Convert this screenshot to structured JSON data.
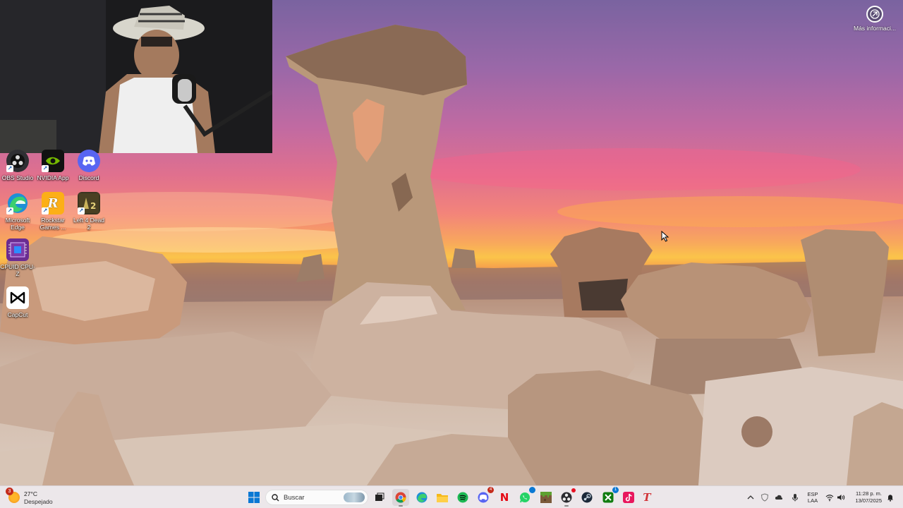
{
  "desktop": {
    "icons": [
      {
        "label": "OBS Studio",
        "icon": "obs-icon",
        "color": "#3a3a3a"
      },
      {
        "label": "NVIDIA App",
        "icon": "nvidia-icon",
        "color": "#76b900"
      },
      {
        "label": "Discord",
        "icon": "discord-icon",
        "color": "#5865f2"
      },
      {
        "label": "Microsoft Edge",
        "icon": "edge-icon",
        "color": "#1f8fd6"
      },
      {
        "label": "Rockstar Games ...",
        "icon": "rockstar-icon",
        "color": "#fcaf17"
      },
      {
        "label": "Left 4 Dead 2",
        "icon": "l4d2-icon",
        "color": "#3b3520"
      },
      {
        "label": "CPUID CPU-Z",
        "icon": "cpuz-icon",
        "color": "#6a2c91"
      },
      {
        "label": "CapCut",
        "icon": "capcut-icon",
        "color": "#ffffff"
      }
    ],
    "more_info": {
      "label": "Más informaci...",
      "icon": "camera-info-icon"
    }
  },
  "taskbar": {
    "weather": {
      "temp": "27°C",
      "condition": "Despejado",
      "badge": "3",
      "icon": "sun-icon"
    },
    "search": {
      "placeholder": "Buscar",
      "icon": "search-icon"
    },
    "pinned": [
      {
        "name": "start",
        "icon": "windows-start-icon"
      },
      {
        "name": "task-view",
        "icon": "task-view-icon"
      },
      {
        "name": "chrome",
        "icon": "chrome-icon"
      },
      {
        "name": "edge",
        "icon": "edge-icon"
      },
      {
        "name": "file-explorer",
        "icon": "folder-icon"
      },
      {
        "name": "spotify",
        "icon": "spotify-icon"
      },
      {
        "name": "discord",
        "icon": "discord-icon",
        "badge": "4"
      },
      {
        "name": "netflix",
        "icon": "netflix-icon",
        "glyph": "N"
      },
      {
        "name": "whatsapp",
        "icon": "whatsapp-icon",
        "badge": "•"
      },
      {
        "name": "minecraft",
        "icon": "minecraft-icon"
      },
      {
        "name": "obs",
        "icon": "obs-icon"
      },
      {
        "name": "steam",
        "icon": "steam-icon"
      },
      {
        "name": "xbox",
        "icon": "xbox-icon",
        "badge": "1"
      },
      {
        "name": "tiktok",
        "icon": "tiktok-icon"
      },
      {
        "name": "typora",
        "icon": "text-app-icon",
        "glyph": "T"
      }
    ],
    "tray": {
      "language_top": "ESP",
      "language_bottom": "LAA",
      "time": "11:28 p. m.",
      "date": "13/07/2025"
    }
  },
  "colors": {
    "taskbar_bg": "#ece7ea",
    "accent": "#0067c0"
  }
}
